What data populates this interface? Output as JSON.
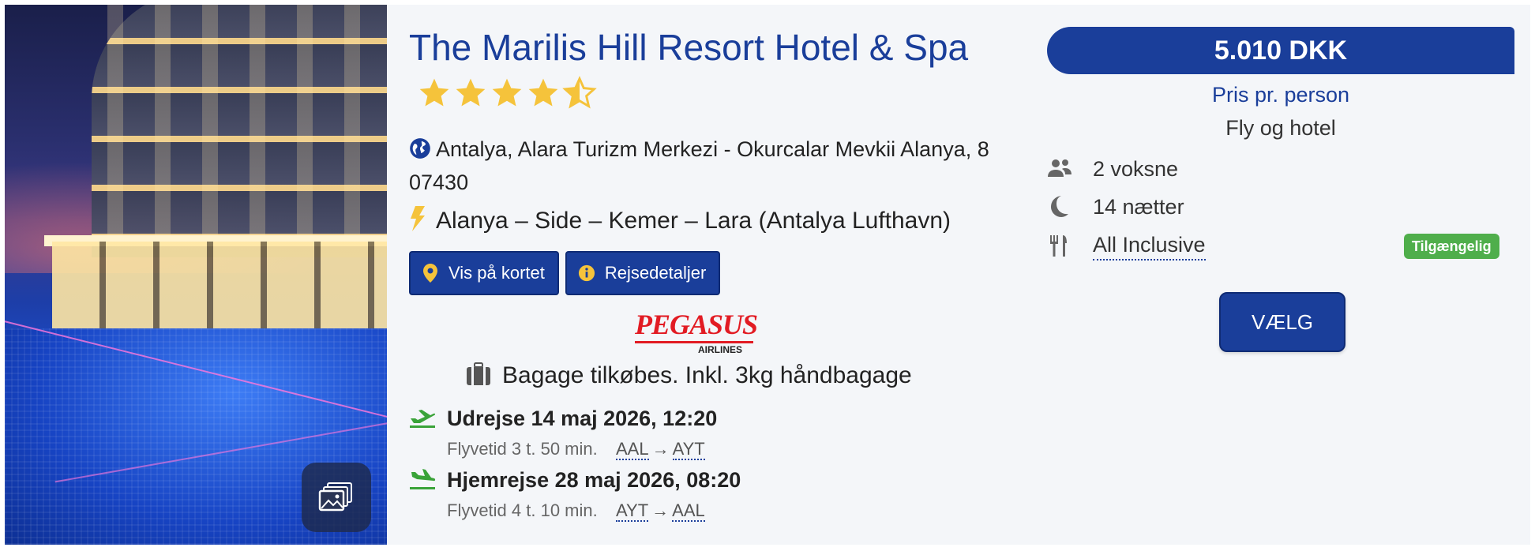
{
  "hotel": {
    "name": "The Marilis Hill Resort Hotel & Spa",
    "rating": 4.5,
    "address": "Antalya, Alara Turizm Merkezi - Okurcalar Mevkii Alanya, 8 07430",
    "airports": "Alanya – Side – Kemer – Lara (Antalya Lufthavn)",
    "photo_icon": "gallery-icon"
  },
  "buttons": {
    "map": "Vis på kortet",
    "details": "Rejsedetaljer",
    "select": "VÆLG"
  },
  "airline": {
    "name": "PEGASUS",
    "sub": "AIRLINES"
  },
  "baggage": "Bagage tilkøbes. Inkl. 3kg håndbagage",
  "flights": {
    "outbound": {
      "title": "Udrejse 14 maj 2026, 12:20",
      "duration": "Flyvetid 3 t. 50 min.",
      "from": "AAL",
      "to": "AYT"
    },
    "inbound": {
      "title": "Hjemrejse 28 maj 2026, 08:20",
      "duration": "Flyvetid 4 t. 10 min.",
      "from": "AYT",
      "to": "AAL"
    }
  },
  "price": {
    "amount": "5.010 DKK",
    "label": "Pris pr. person",
    "type": "Fly og hotel"
  },
  "details": {
    "guests": "2 voksne",
    "nights": "14 nætter",
    "board": "All Inclusive",
    "availability": "Tilgængelig"
  },
  "colors": {
    "brand": "#1a3e9a",
    "star": "#f5c33b",
    "available": "#4fae4b",
    "flight_icon": "#3aa339"
  }
}
